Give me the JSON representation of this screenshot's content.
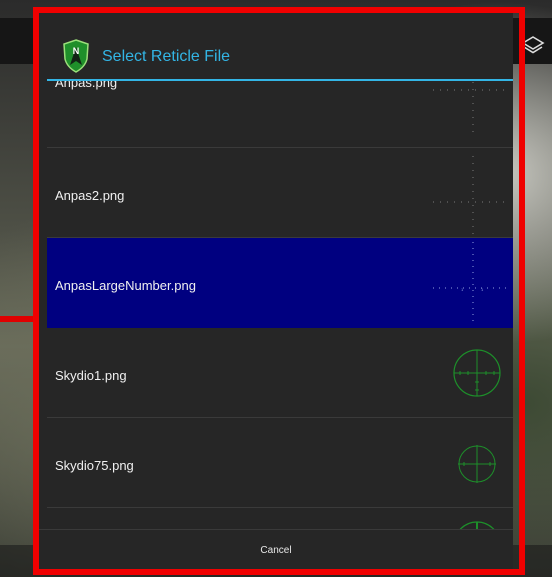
{
  "dialog": {
    "title": "Select Reticle File",
    "cancel_label": "Cancel",
    "accent_color": "#33b5e5",
    "selected_color": "#000080"
  },
  "files": [
    {
      "name": "Anpas.png",
      "selected": false,
      "reticle": "anpas-reticle-icon"
    },
    {
      "name": "Anpas2.png",
      "selected": false,
      "reticle": "anpas-reticle-icon"
    },
    {
      "name": "AnpasLargeNumber.png",
      "selected": true,
      "reticle": "anpas-reticle-icon"
    },
    {
      "name": "Skydio1.png",
      "selected": false,
      "reticle": "green-circle-reticle-icon"
    },
    {
      "name": "Skydio75.png",
      "selected": false,
      "reticle": "green-circle-reticle-icon"
    },
    {
      "name": "",
      "selected": false,
      "reticle": "green-circle-reticle-icon"
    }
  ]
}
